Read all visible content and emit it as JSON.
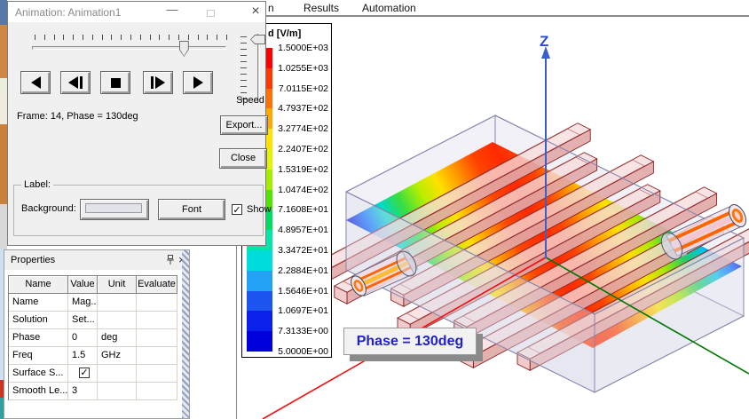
{
  "menu": {
    "items": [
      {
        "label": "n"
      },
      {
        "label": "Results"
      },
      {
        "label": "Automation"
      }
    ]
  },
  "animation_dialog": {
    "title": "Animation: Animation1",
    "frame_status": "Frame: 14, Phase = 130deg",
    "speed_label": "Speed",
    "export_button": "Export...",
    "close_button": "Close",
    "controls": [
      "play-reverse",
      "step-reverse",
      "stop",
      "step-forward",
      "play-forward"
    ],
    "frame_slider_pct": 78,
    "label_group": {
      "title": "Label:",
      "background_label": "Background:",
      "font_button": "Font",
      "show_checkbox_label": "Show",
      "show_checked": true,
      "check_glyph": "✓"
    }
  },
  "properties_panel": {
    "title": "Properties",
    "columns": [
      "Name",
      "Value",
      "Unit",
      "Evaluate"
    ],
    "rows": [
      {
        "name": "Name",
        "value": "Mag...",
        "unit": "",
        "evaluated": ""
      },
      {
        "name": "Solution",
        "value": "Set...",
        "unit": "",
        "evaluated": ""
      },
      {
        "name": "Phase",
        "value": "0",
        "unit": "deg",
        "evaluated": ""
      },
      {
        "name": "Freq",
        "value": "1.5",
        "unit": "GHz",
        "evaluated": ""
      },
      {
        "name": "Surface S...",
        "value": "",
        "checkbox": true,
        "checked": true,
        "unit": "",
        "evaluated": ""
      },
      {
        "name": "Smooth Le...",
        "value": "3",
        "unit": "",
        "evaluated": ""
      }
    ]
  },
  "legend": {
    "header": "d [V/m]",
    "values": [
      "1.5000E+03",
      "1.0255E+03",
      "7.0115E+02",
      "4.7937E+02",
      "3.2774E+02",
      "2.2407E+02",
      "1.5319E+02",
      "1.0474E+02",
      "7.1608E+01",
      "4.8957E+01",
      "3.3472E+01",
      "2.2884E+01",
      "1.5646E+01",
      "1.0697E+01",
      "7.3133E+00",
      "5.0000E+00"
    ],
    "band_colors": [
      "#ff0000",
      "#ff3800",
      "#ff7100",
      "#ffa900",
      "#ffe200",
      "#e4f400",
      "#a6ed00",
      "#52e400",
      "#00dd66",
      "#00e7a8",
      "#00dcdc",
      "#23a2f5",
      "#1c55f0",
      "#0b20ea",
      "#0000dc"
    ]
  },
  "viewport": {
    "z_axis_label": "Z",
    "phase_label": "Phase = 130deg",
    "axis_colors": {
      "x": "#ee1111",
      "y": "#007700",
      "z": "#3a5fcd"
    },
    "phase_label_color": "#2020cc"
  }
}
